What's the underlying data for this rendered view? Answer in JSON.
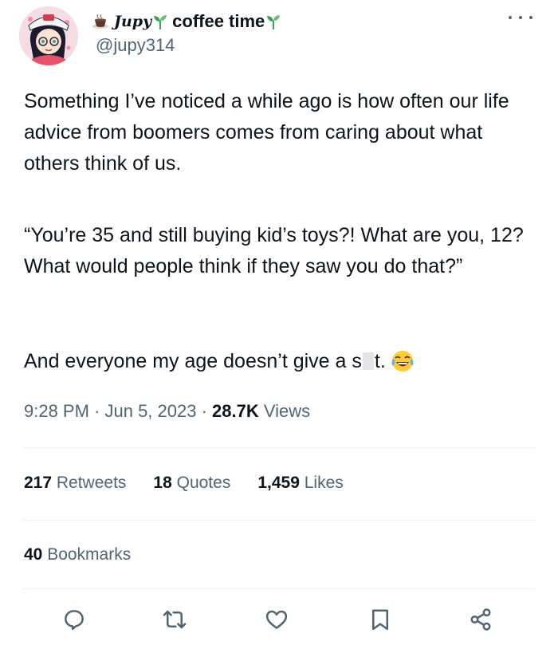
{
  "author": {
    "display_name_script": "Jupy",
    "display_name_text": "coffee time",
    "handle": "@jupy314"
  },
  "tweet": {
    "paragraph1": "Something I’ve noticed a while ago is how often our life advice from boomers comes from caring about what others think of us.",
    "paragraph2": "“You’re 35 and still buying kid’s toys?! What are you, 12? What would people think if they saw you do that?”",
    "paragraph3_before": "And everyone my age doesn’t give a s",
    "paragraph3_after": "t."
  },
  "meta": {
    "time_date": "9:28 PM · Jun 5, 2023 · ",
    "views_count": "28.7K",
    "views_label": " Views"
  },
  "stats": {
    "retweets_count": "217",
    "retweets_label": " Retweets",
    "quotes_count": "18",
    "quotes_label": " Quotes",
    "likes_count": "1,459",
    "likes_label": " Likes",
    "bookmarks_count": "40",
    "bookmarks_label": " Bookmarks"
  },
  "icons": {
    "more": "more-horizontal-icon",
    "reply": "reply-icon",
    "retweet": "retweet-icon",
    "like": "heart-icon",
    "bookmark": "bookmark-icon",
    "share": "share-icon"
  },
  "colors": {
    "text": "#0f1419",
    "secondary": "#536471",
    "sprout": "#3aa55b"
  }
}
